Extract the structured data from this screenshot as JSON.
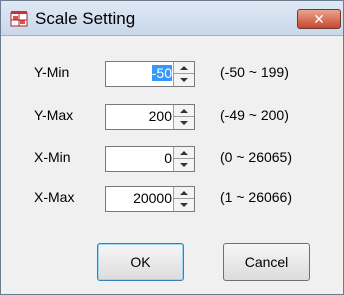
{
  "window": {
    "title": "Scale Setting",
    "close_label": "✕",
    "icon": "app-scale-icon"
  },
  "fields": [
    {
      "label": "Y-Min",
      "value": "-50",
      "range": "(-50 ~ 199)",
      "selected": true
    },
    {
      "label": "Y-Max",
      "value": "200",
      "range": "(-49 ~ 200)",
      "selected": false
    },
    {
      "label": "X-Min",
      "value": "0",
      "range": "(0 ~ 26065)",
      "selected": false
    },
    {
      "label": "X-Max",
      "value": "20000",
      "range": "(1 ~ 26066)",
      "selected": false
    }
  ],
  "buttons": {
    "ok_label": "OK",
    "cancel_label": "Cancel"
  },
  "colors": {
    "selection": "#3399ff",
    "close_button": "#c7472f",
    "title_bar": "#dfe9f5"
  }
}
